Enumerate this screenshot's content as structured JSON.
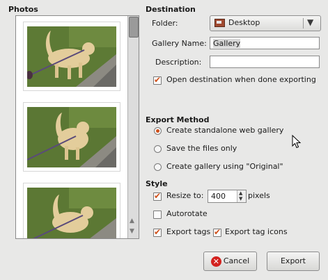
{
  "photos": {
    "title": "Photos"
  },
  "destination": {
    "heading": "Destination",
    "folder_label": "Folder:",
    "folder_value": "Desktop",
    "gallery_name_label": "Gallery Name:",
    "gallery_name_value": "Gallery",
    "description_label": "Description:",
    "description_value": "",
    "open_destination_label": "Open destination when done exporting",
    "open_destination_checked": true
  },
  "export_method": {
    "heading": "Export Method",
    "options": [
      {
        "label": "Create standalone web gallery",
        "selected": true
      },
      {
        "label": "Save the files only",
        "selected": false
      },
      {
        "label": "Create gallery using \"Original\"",
        "selected": false
      }
    ]
  },
  "style": {
    "heading": "Style",
    "resize_label": "Resize to:",
    "resize_checked": true,
    "resize_value": "400",
    "resize_unit": "pixels",
    "autorotate_label": "Autorotate",
    "autorotate_checked": false,
    "export_tags_label": "Export tags",
    "export_tags_checked": true,
    "export_tag_icons_label": "Export tag icons",
    "export_tag_icons_checked": true
  },
  "buttons": {
    "cancel": "Cancel",
    "export": "Export"
  },
  "icons": {
    "folder": "folder-icon",
    "dropdown": "combo-arrow-icon",
    "cancel": "cancel-icon",
    "cursor": "mouse-pointer-icon"
  },
  "colors": {
    "accent": "#d0501a",
    "background": "#e8e8e7"
  }
}
